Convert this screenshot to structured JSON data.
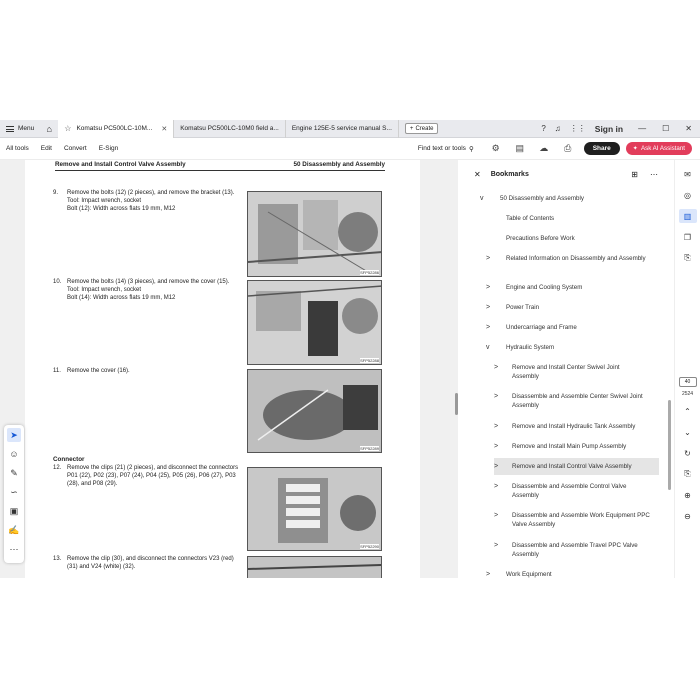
{
  "titlebar": {
    "menu_label": "Menu",
    "tabs": [
      {
        "label": "Komatsu PC500LC-10M..."
      },
      {
        "label": "Komatsu PC500LC-10M0 field a..."
      },
      {
        "label": "Engine 125E-5 service manual S..."
      }
    ],
    "create_label": "Create",
    "signin_label": "Sign in"
  },
  "toolbar": {
    "all_tools": "All tools",
    "edit": "Edit",
    "convert": "Convert",
    "esign": "E-Sign",
    "find_label": "Find text or tools",
    "share_label": "Share",
    "ai_label": "Ask AI Assistant"
  },
  "document": {
    "header_left": "Remove and Install Control Valve Assembly",
    "header_right": "50 Disassembly and Assembly",
    "connector_heading": "Connector",
    "steps": [
      {
        "num": "9.",
        "text": "Remove the bolts (12) (2 pieces), and remove the bracket (13).",
        "line2": "Tool: Impact wrench, socket",
        "line3": "Bolt (12): Width across flats 19 mm, M12"
      },
      {
        "num": "10.",
        "text": "Remove the bolts (14) (3 pieces), and remove the cover (15).",
        "line2": "Tool: Impact wrench, socket",
        "line3": "Bolt (14): Width across flats 19 mm, M12"
      },
      {
        "num": "11.",
        "text": "Remove the cover (16).",
        "line2": "",
        "line3": ""
      },
      {
        "num": "12.",
        "text": "Remove the clips (21) (2 pieces), and disconnect the connectors P01 (22), P02 (23), P07 (24), P04 (25), P05 (26), P06 (27), P03 (28), and P08 (29).",
        "line2": "",
        "line3": ""
      },
      {
        "num": "13.",
        "text": "Remove the clip (30), and disconnect the connectors V23 (red) (31) and V24 (white) (32).",
        "line2": "",
        "line3": ""
      }
    ],
    "figures": [
      {
        "code": "SFP52286"
      },
      {
        "code": "SFP52288"
      },
      {
        "code": "SFP52289"
      },
      {
        "code": "SFP52290"
      },
      {
        "code": ""
      }
    ]
  },
  "bookmarks": {
    "title": "Bookmarks",
    "items": [
      {
        "label": "50 Disassembly and Assembly",
        "chev": "v"
      },
      {
        "label": "Table of Contents",
        "chev": ""
      },
      {
        "label": "Precautions Before Work",
        "chev": ""
      },
      {
        "label": "Related Information on Disassembly and Assembly",
        "chev": ">"
      },
      {
        "label": "Engine and Cooling System",
        "chev": ">"
      },
      {
        "label": "Power Train",
        "chev": ">"
      },
      {
        "label": "Undercarriage and Frame",
        "chev": ">"
      },
      {
        "label": "Hydraulic System",
        "chev": "v"
      },
      {
        "label": "Remove and Install Center Swivel Joint Assembly",
        "chev": ">"
      },
      {
        "label": "Disassemble and Assemble Center Swivel Joint Assembly",
        "chev": ">"
      },
      {
        "label": "Remove and Install Hydraulic Tank Assembly",
        "chev": ">"
      },
      {
        "label": "Remove and Install Main Pump Assembly",
        "chev": ">"
      },
      {
        "label": "Remove and Install Control Valve Assembly",
        "chev": ">"
      },
      {
        "label": "Disassemble and Assemble Control Valve Assembly",
        "chev": ">"
      },
      {
        "label": "Disassemble and Assemble Work Equipment PPC Valve Assembly",
        "chev": ">"
      },
      {
        "label": "Disassemble and Assemble Travel PPC Valve Assembly",
        "chev": ">"
      },
      {
        "label": "Work Equipment",
        "chev": ">"
      }
    ]
  },
  "rail": {
    "page_current": "40",
    "page_total": "2524"
  }
}
